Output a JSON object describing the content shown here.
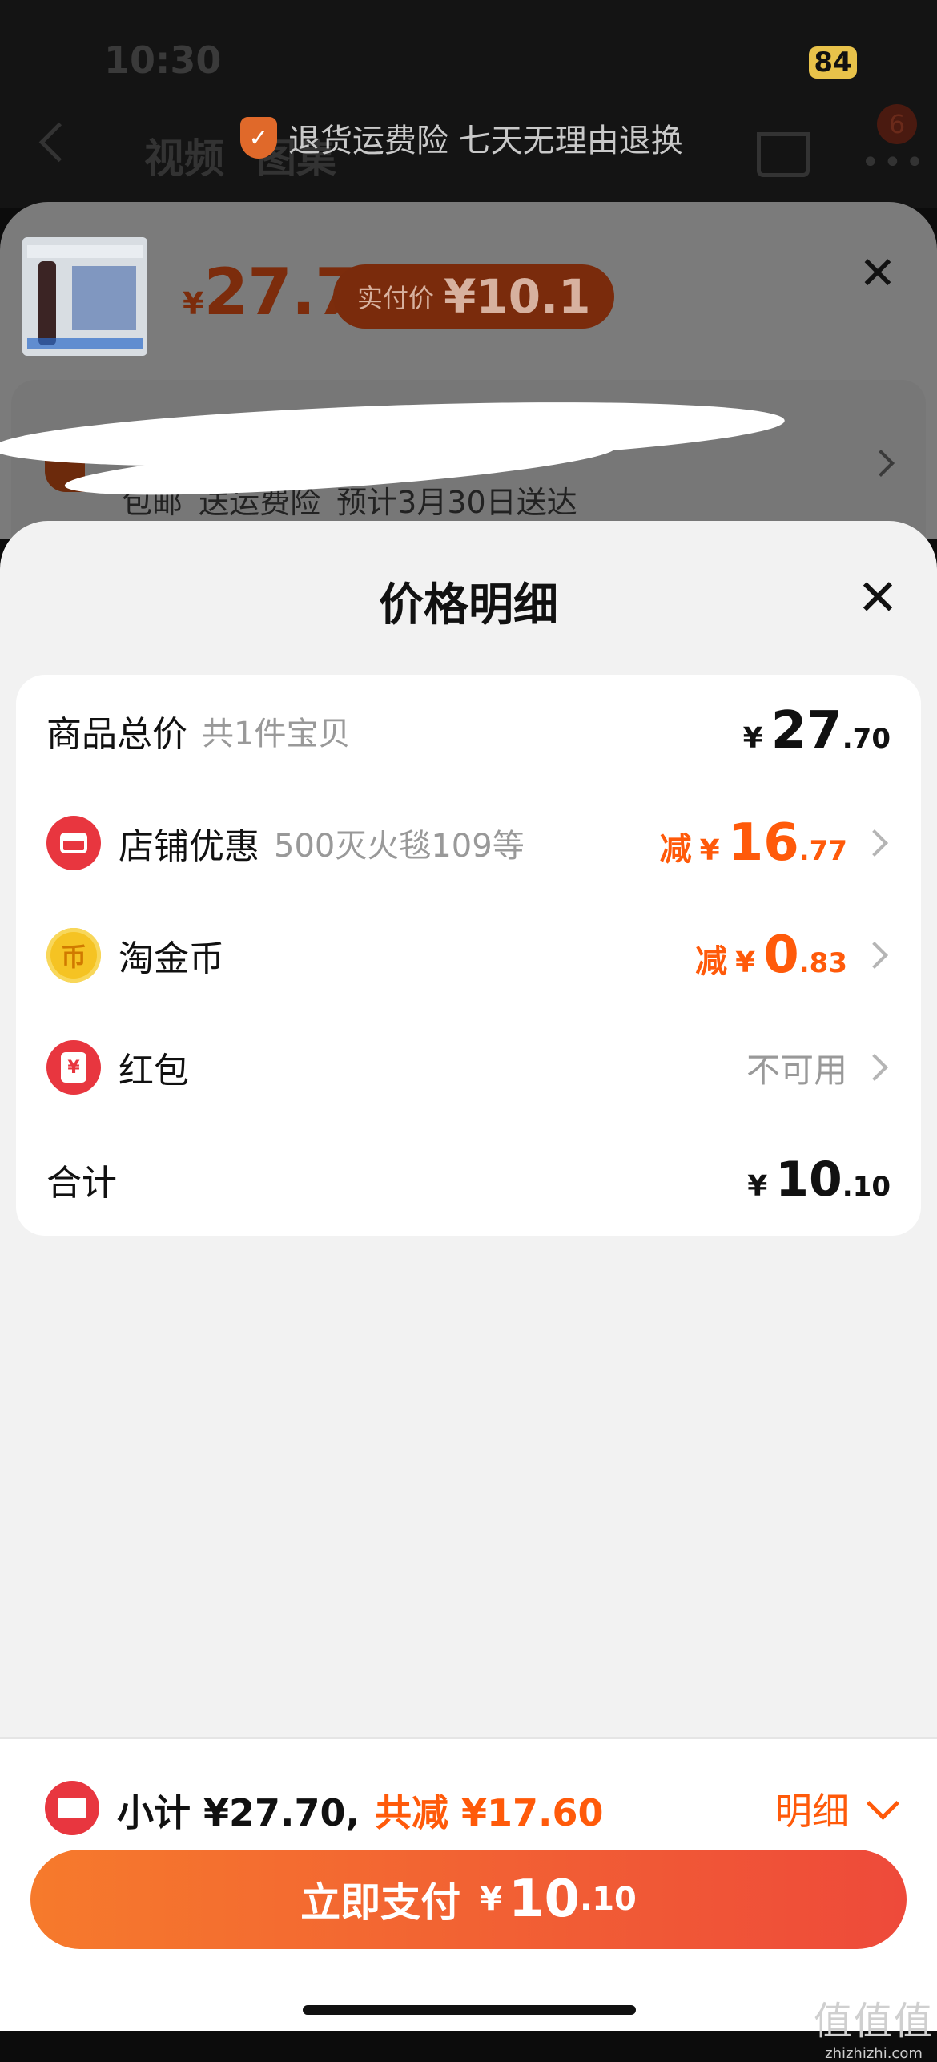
{
  "status_bar": {
    "time": "10:30",
    "battery": "84"
  },
  "bg_nav": {
    "tab1": "视频",
    "tab2": "图集",
    "cart_badge": "6"
  },
  "toast": {
    "text": "退货运费险 七天无理由退换"
  },
  "product": {
    "currency": "¥",
    "price": "27.7",
    "pay_label": "实付价",
    "pay_price": "¥10.1"
  },
  "address": {
    "text": "包邮 送运费险 预计3月30日送达"
  },
  "price_detail": {
    "title": "价格明细",
    "rows": [
      {
        "title": "商品总价",
        "sub": "共1件宝贝",
        "currency": "¥",
        "int": "27",
        "dec": ".70"
      },
      {
        "title": "店铺优惠",
        "sub": "500灭火毯109等",
        "prefix": "减",
        "currency": "¥",
        "int": "16",
        "dec": ".77"
      },
      {
        "title": "淘金币",
        "prefix": "减",
        "currency": "¥",
        "int": "0",
        "dec": ".83"
      },
      {
        "title": "红包",
        "value": "不可用"
      },
      {
        "title": "合计",
        "currency": "¥",
        "int": "10",
        "dec": ".10"
      }
    ]
  },
  "bottom": {
    "subtotal": "小计 ¥27.70,",
    "saved": "共减 ¥17.60",
    "detail_link": "明细",
    "pay_label": "立即支付",
    "pay_currency": "¥",
    "pay_int": "10",
    "pay_dec": ".10"
  },
  "watermark": {
    "top": "值值值",
    "bottom": "zhizhizhi.com"
  },
  "colors": {
    "accent": "#ff5a0a",
    "pay_gradient_start": "#f67a2c",
    "pay_gradient_end": "#ee4a3a",
    "panel_bg": "#f2f2f2"
  },
  "icons": {
    "store": "store-icon",
    "coin": "coin-icon",
    "red_packet": "red-packet-icon",
    "coupon": "coupon-icon"
  }
}
